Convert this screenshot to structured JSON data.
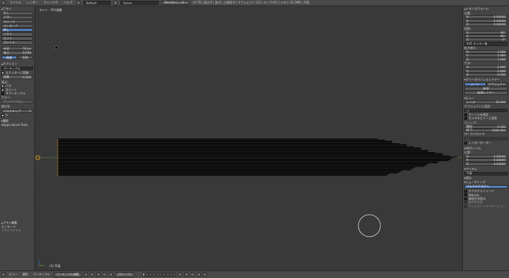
{
  "topbar": {
    "menu": [
      "ファイル",
      "レンダー",
      "ウィンドウ",
      "ヘルプ"
    ],
    "screen_layout": "Default",
    "scene": "Scene",
    "render_engine": "Blenderレンダー",
    "stats": "v2.79 | 頂点:0 | 面:0 | 三角面:0 | オブジェクト:1/2 | ランプ:0/1 | メモリ:33.5MB | 平面"
  },
  "left_panel": {
    "brush_title": "ブラシ",
    "brush_items": [
      "なし",
      "ドロー",
      "スムーズ",
      "ストローク",
      "押し",
      "ハサミ",
      "カット",
      "グレイド"
    ],
    "brush_active_index": 4,
    "radius_label": "半径",
    "radius_value": "50 px",
    "strength_label": "強さ",
    "strength_value": "0.500",
    "add_label": "追加",
    "subtract_label": "削除",
    "options_title": "オプション",
    "options_mode": "パーティクル",
    "emitter_label": "エミッターに距離",
    "distance_label": "距離",
    "distance_value": "0.250",
    "display_label": "表示:",
    "check_path": "パス",
    "check_points": "ポイント",
    "check_children": "子パーティクル",
    "color_label": "カラー:",
    "color_button": "ナンバーブラシ",
    "subdiv_label": "細分化",
    "subdiv_mode": "パスステップ",
    "subdiv_value": "2",
    "x_label": "X",
    "history_title": "履歴",
    "grease_title": "Apply Bevel Tools",
    "brush_edit_title": "ブラシ編集",
    "stroke_label": "ストローク",
    "stroke_sub": "ブラシアイテム"
  },
  "viewport": {
    "label": "ライト - 平行投影",
    "footer": "(1) 平面"
  },
  "right_panel": {
    "transform_title": "トランスフォーム",
    "location_label": "位置:",
    "location": [
      {
        "axis": "X:",
        "value": "0.00000"
      },
      {
        "axis": "Y:",
        "value": "0.00000"
      },
      {
        "axis": "Z:",
        "value": "0.00000"
      }
    ],
    "rotation_label": "回転:",
    "rotation": [
      {
        "axis": "X:",
        "value": "90°"
      },
      {
        "axis": "Y:",
        "value": "90°"
      },
      {
        "axis": "Z:",
        "value": "0°"
      }
    ],
    "rotation_mode": "XYZ オイラー角",
    "scale_label": "拡大縮小:",
    "scale": [
      {
        "axis": "X:",
        "value": "1.000"
      },
      {
        "axis": "Y:",
        "value": "1.000"
      },
      {
        "axis": "Z:",
        "value": "1.000"
      }
    ],
    "dimensions_label": "寸法:",
    "dimensions": [
      {
        "axis": "X:",
        "value": "2.000"
      },
      {
        "axis": "Y:",
        "value": "2.000"
      },
      {
        "axis": "Z:",
        "value": "0.000"
      }
    ],
    "grease_title": "グリースペンシルレイヤー",
    "scene_button": "シーン",
    "object_button": "オブジェクト",
    "new_button": "新規",
    "new_layer_button": "新規レイヤー",
    "view_title": "ビュー",
    "lens_label": "レンズ:",
    "lens_value": "35.000",
    "lock_object_label": "オブジェクトに固定:",
    "lock_cursor_label": "カーソルを固定",
    "lock_camera_label": "カメラをビューに固定",
    "clip_label": "クリップ:",
    "clip_start_label": "開始:",
    "clip_start_value": "0.100",
    "clip_end_label": "終了:",
    "clip_end_value": "1000.000",
    "local_camera_label": "ローカルカメラ:",
    "render_border_label": "レンダーボーダー",
    "cursor_title": "3Dカーソル",
    "cursor_location_label": "位置:",
    "cursor_location": [
      {
        "axis": "X:",
        "value": "0.00000"
      },
      {
        "axis": "Y:",
        "value": "0.00000"
      },
      {
        "axis": "Z:",
        "value": "0.00000"
      }
    ],
    "item_title": "アイテム",
    "item_name": "平面",
    "display_title": "表示",
    "shading_title": "シェーディング",
    "shading_mode": "マルチテクスチャ",
    "shading_checks": [
      "テクスチャソリッド",
      "Matcap",
      "裏面の非表示",
      "被写界深度",
      "アンビエントオクルージョン"
    ]
  },
  "bottom_bar": {
    "view": "ビュー",
    "select": "選択",
    "particle": "パーティクル",
    "mode": "パーティクル編集",
    "pivot": "グローバル"
  },
  "colors": {
    "panel_bg": "#444444",
    "viewport_bg": "#393939",
    "accent_blue": "#5680c2",
    "axis_green": "#5a9a3a",
    "object_origin": "#f0a030"
  }
}
